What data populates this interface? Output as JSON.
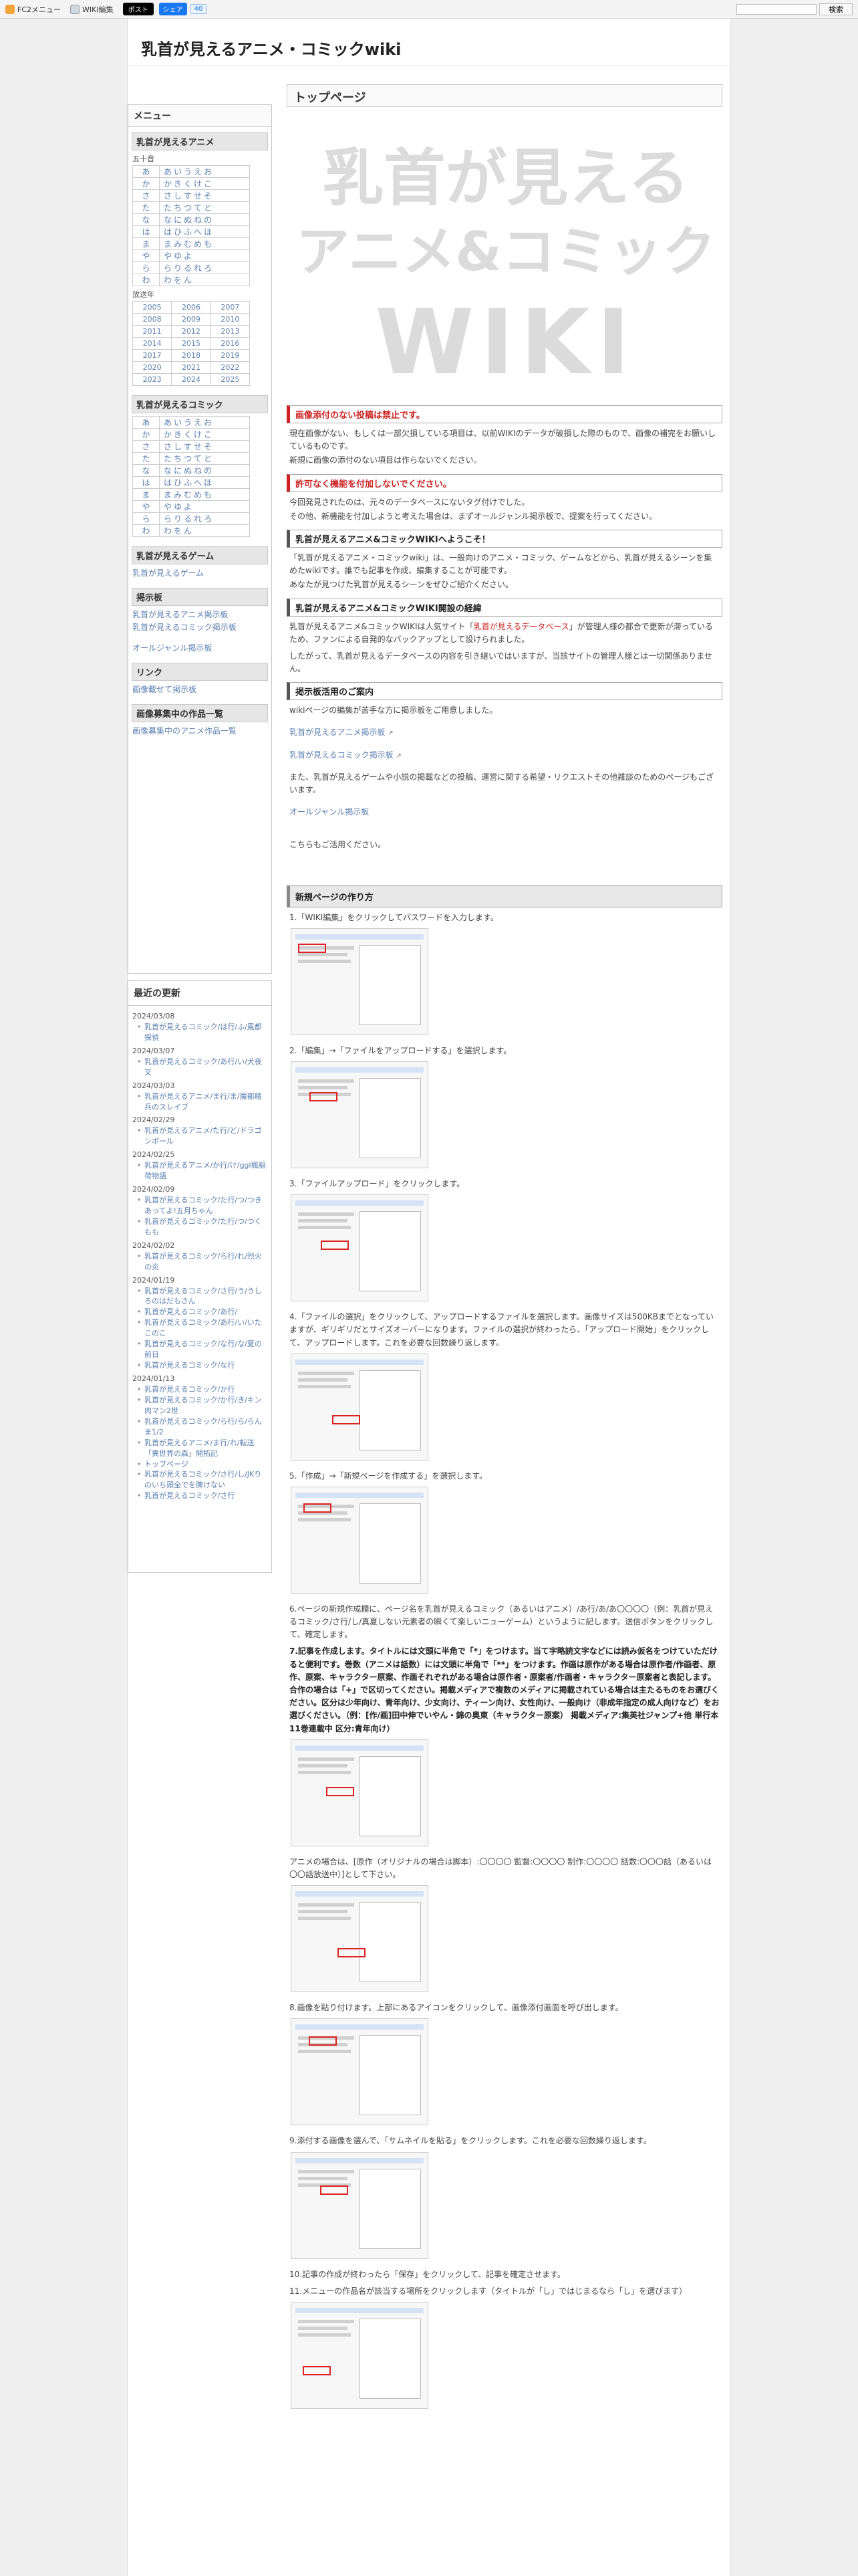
{
  "topbar": {
    "fc2_menu": "FC2メニュー",
    "wiki_edit": "WIKI編集",
    "x_post": "ポスト",
    "fb_share": "シェア",
    "fb_count": "40",
    "search_btn": "検索",
    "search_placeholder": ""
  },
  "site": {
    "title": "乳首が見えるアニメ・コミックwiki"
  },
  "sidebar": {
    "menu_title": "メニュー",
    "anime_section": "乳首が見えるアニメ",
    "gojuon_label": "五十音",
    "anime_kana": [
      [
        "あ",
        "あいうえお"
      ],
      [
        "か",
        "かきくけこ"
      ],
      [
        "さ",
        "さしすせそ"
      ],
      [
        "た",
        "たちつてと"
      ],
      [
        "な",
        "なにぬねの"
      ],
      [
        "は",
        "はひふへほ"
      ],
      [
        "ま",
        "まみむめも"
      ],
      [
        "や",
        "やゆよ"
      ],
      [
        "ら",
        "らりるれろ"
      ],
      [
        "わ",
        "わをん"
      ]
    ],
    "year_label": "放送年",
    "years": [
      [
        "2005",
        "2006",
        "2007"
      ],
      [
        "2008",
        "2009",
        "2010"
      ],
      [
        "2011",
        "2012",
        "2013"
      ],
      [
        "2014",
        "2015",
        "2016"
      ],
      [
        "2017",
        "2018",
        "2019"
      ],
      [
        "2020",
        "2021",
        "2022"
      ],
      [
        "2023",
        "2024",
        "2025"
      ]
    ],
    "comic_section": "乳首が見えるコミック",
    "comic_kana": [
      [
        "あ",
        "あいうえお"
      ],
      [
        "か",
        "かきくけこ"
      ],
      [
        "さ",
        "さしすせそ"
      ],
      [
        "た",
        "たちつてと"
      ],
      [
        "な",
        "なにぬねの"
      ],
      [
        "は",
        "はひふへほ"
      ],
      [
        "ま",
        "まみむめも"
      ],
      [
        "や",
        "やゆよ"
      ],
      [
        "ら",
        "らりるれろ"
      ],
      [
        "わ",
        "わをん"
      ]
    ],
    "game_section": "乳首が見えるゲーム",
    "game_link": "乳首が見えるゲーム",
    "board_section": "掲示板",
    "board_links": [
      "乳首が見えるアニメ掲示板",
      "乳首が見えるコミック掲示板",
      "オールジャンル掲示板"
    ],
    "link_section": "リンク",
    "link_links": [
      "画像載せて掲示板"
    ],
    "recruit_section": "画像募集中の作品一覧",
    "recruit_link": "画像募集中のアニメ作品一覧"
  },
  "updates": {
    "title": "最近の更新",
    "groups": [
      {
        "date": "2024/03/08",
        "items": [
          "乳首が見えるコミック/は行/ふ/風都探偵"
        ]
      },
      {
        "date": "2024/03/07",
        "items": [
          "乳首が見えるコミック/あ行/い/犬夜叉"
        ]
      },
      {
        "date": "2024/03/03",
        "items": [
          "乳首が見えるアニメ/ま行/ま/魔都精兵のスレイブ"
        ]
      },
      {
        "date": "2024/02/29",
        "items": [
          "乳首が見えるアニメ/た行/ど/ドラゴンボール"
        ]
      },
      {
        "date": "2024/02/25",
        "items": [
          "乳首が見えるアニメ/か行/け/ggl楓稲荷物語"
        ]
      },
      {
        "date": "2024/02/09",
        "items": [
          "乳首が見えるコミック/た行/つ/つきあってよ!五月ちゃん",
          "乳首が見えるコミック/た行/つ/つくもも"
        ]
      },
      {
        "date": "2024/02/02",
        "items": [
          "乳首が見えるコミック/ら行/れ/烈火の炎"
        ]
      },
      {
        "date": "2024/01/19",
        "items": [
          "乳首が見えるコミック/さ行/う/うしろのはだもさん",
          "乳首が見えるコミック/あ行/",
          "乳首が見えるコミック/あ行/い/いたこのこ",
          "乳首が見えるコミック/な行/な/夏の前日",
          "乳首が見えるコミック/な行"
        ]
      },
      {
        "date": "2024/01/13",
        "items": [
          "乳首が見えるコミック/か行",
          "乳首が見えるコミック/か行/き/キン肉マン2世",
          "乳首が見えるコミック/ら行/ら/らんま1/2",
          "乳首が見えるアニメ/ま行/れ/転送「異世界の森」開拓記",
          "トップページ",
          "乳首が見えるコミック/さ行/し/JKりのいち頭全でを脾けない",
          "乳首が見えるコミック/さ行"
        ]
      }
    ]
  },
  "main": {
    "page_title": "トップページ",
    "logo_lines": [
      "乳首が見える",
      "アニメ&コミック",
      "WIKI"
    ],
    "h1": "画像添付のない投稿は禁止です。",
    "p1": [
      "現在画像がない、もしくは一部欠損している項目は、以前WIKIのデータが破損した際のもので、画像の補完をお願いしているものです。",
      "新規に画像の添付のない項目は作らないでください。"
    ],
    "h2": "許可なく機能を付加しないでください。",
    "p2": [
      "今回発見されたのは、元々のデータベースにないタグ付けでした。",
      "その他、新機能を付加しようと考えた場合は、まずオールジャンル掲示板で、提案を行ってください。"
    ],
    "h3": "乳首が見えるアニメ&コミックWIKIへようこそ！",
    "p3": [
      "「乳首が見えるアニメ・コミックwiki」は、一般向けのアニメ・コミック、ゲームなどから、乳首が見えるシーンを集めたwikiです。誰でも記事を作成、編集することが可能です。",
      "あなたが見つけた乳首が見えるシーンをぜひご紹介ください。"
    ],
    "h4": "乳首が見えるアニメ&コミックWIKI開設の経緯",
    "p4_pre": "乳首が見えるアニメ&コミックWIKIは人気サイト「",
    "p4_hl": "乳首が見えるデータベース",
    "p4_post": "」が管理人様の都合で更新が滞っているため、ファンによる自発的なバックアップとして設けられました。",
    "p4b": "したがって、乳首が見えるデータベースの内容を引き継いではいますが、当該サイトの管理人様とは一切関係ありません。",
    "h5": "掲示板活用のご案内",
    "p5": "wikiページの編集が苦手な方に掲示板をご用意しました。",
    "board1": "乳首が見えるアニメ掲示板",
    "board2": "乳首が見えるコミック掲示板",
    "p6": "また、乳首が見えるゲームや小説の掲載などの投稿、運営に関する希望・リクエストその他雑談のためのページもございます。",
    "board3": "オールジャンル掲示板",
    "p7": "こちらもご活用ください。",
    "h6": "新規ページの作り方",
    "steps": [
      "1.「WIKI編集」をクリックしてパスワードを入力します。",
      "2.「編集」→「ファイルをアップロードする」を選択します。",
      "3.「ファイルアップロード」をクリックします。",
      "4.「ファイルの選択」をクリックして、アップロードするファイルを選択します。画像サイズは500KBまでとなっていますが、ギリギリだとサイズオーバーになります。ファイルの選択が終わったら、「アップロード開始」をクリックして、アップロードします。これを必要な回数繰り返します。",
      "5.「作成」→「新規ページを作成する」を選択します。",
      "6.ページの新規作成欄に、ページ名を乳首が見えるコミック（あるいはアニメ）/あ行/あ/あ〇〇〇〇（例：乳首が見えるコミック/さ行/し/真夏しない元素者の瞬くて楽しいニューゲーム）というように記します。送信ボタンをクリックして、確定します。",
      "7.記事を作成します。タイトルには文頭に半角で「*」をつけます。当て字略読文字などには読み仮名をつけていただけると便利です。巻数（アニメは話数）には文頭に半角で「**」をつけます。作画は原作がある場合は原作者/作画者、原作、原案、キャラクター原案、作画それぞれがある場合は原作者・原案者/作画者・キャラクター原案者と表記します。合作の場合は「+」で区切ってください。掲載メディアで複数のメディアに掲載されている場合は主たるものをお選びください。区分は少年向け、青年向け、少女向け、ティーン向け、女性向け、一般向け（非成年指定の成人向けなど）をお選びください。（例：[作/画]田中伸でいやん・錦の奥東（キャラクター原案） 掲載メディア:集英社ジャンプ+他 単行本11巻連載中 区分:青年向け）",
      "アニメの場合は、[原作（オリジナルの場合は脚本）:〇〇〇〇 監督:〇〇〇〇 制作:〇〇〇〇 話数:〇〇〇話（あるいは〇〇話放送中）]として下さい。",
      "8.画像を貼り付けます。上部にあるアイコンをクリックして、画像添付画面を呼び出します。",
      "9.添付する画像を選んで、「サムネイルを貼る」をクリックします。これを必要な回数繰り返します。",
      "10.記事の作成が終わったら「保存」をクリックして、記事を確定させます。",
      "11.メニューの作品名が該当する場所をクリックします（タイトルが「し」ではじまるなら「し」を選びます）"
    ]
  }
}
